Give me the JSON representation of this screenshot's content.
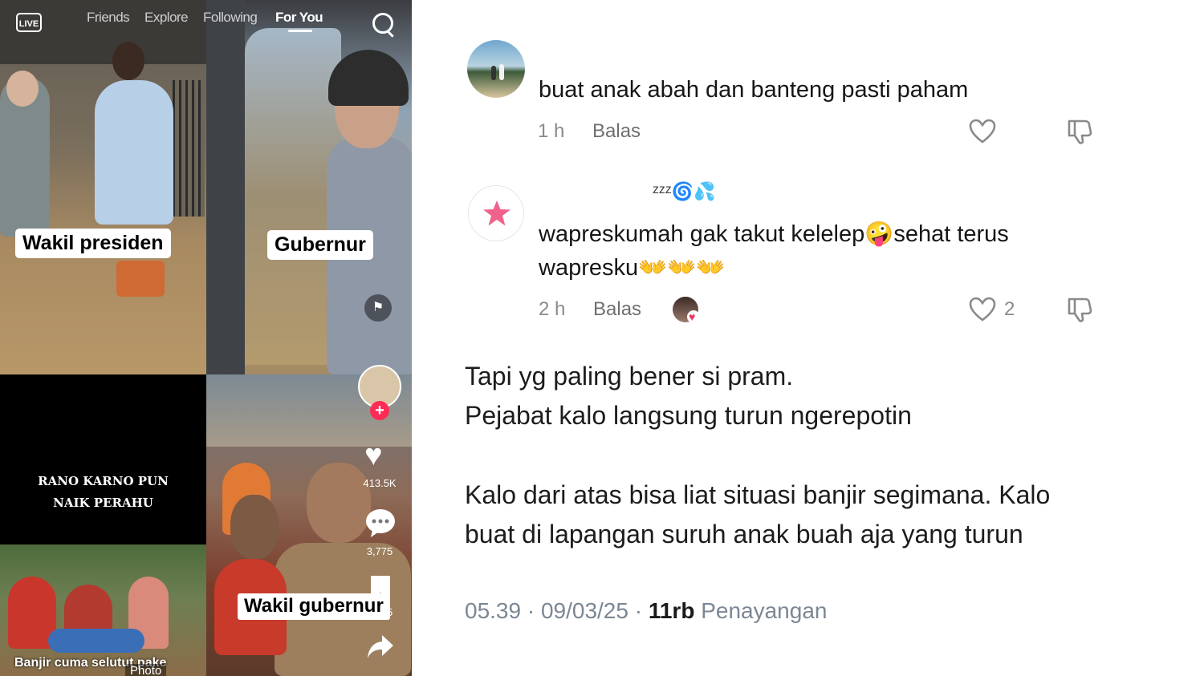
{
  "tiktok": {
    "nav": {
      "live": "LIVE",
      "tabs": [
        "Friends",
        "Explore",
        "Following",
        "For You"
      ],
      "active_tab": "For You"
    },
    "tiles": {
      "wakil_presiden_label": "Wakil presiden",
      "gubernur_label": "Gubernur",
      "rano_caption_line1": "RANO KARNO PUN",
      "rano_caption_line2": "NAIK PERAHU",
      "wakil_gubernur_label": "Wakil gubernur",
      "banjir_caption": "Banjir cuma selutut pake",
      "photo_tag": "Photo"
    },
    "sidebar": {
      "likes": "413.5K",
      "comments": "3,775",
      "saves": "9,095"
    }
  },
  "comments": [
    {
      "username": "",
      "text": "buat anak abah dan banteng pasti paham",
      "time": "1 h",
      "reply_label": "Balas",
      "likes": ""
    },
    {
      "username": "",
      "username_emoji": "ᶻᶻᶻ🌀💦",
      "text_line1": "wapreskumah gak takut kelelep🤪sehat terus",
      "text_line2": "wapresku👐👐👐",
      "time": "2 h",
      "reply_label": "Balas",
      "likes": "2"
    }
  ],
  "tweet": {
    "line1": "Tapi yg paling bener si pram.",
    "line2": "Pejabat kalo langsung turun ngerepotin",
    "line3": "Kalo dari atas bisa liat situasi banjir segimana. Kalo",
    "line4": "buat di lapangan suruh anak buah aja yang turun",
    "time": "05.39 · 09/03/25 · ",
    "views_count": "11rb",
    "views_label": " Penayangan"
  }
}
